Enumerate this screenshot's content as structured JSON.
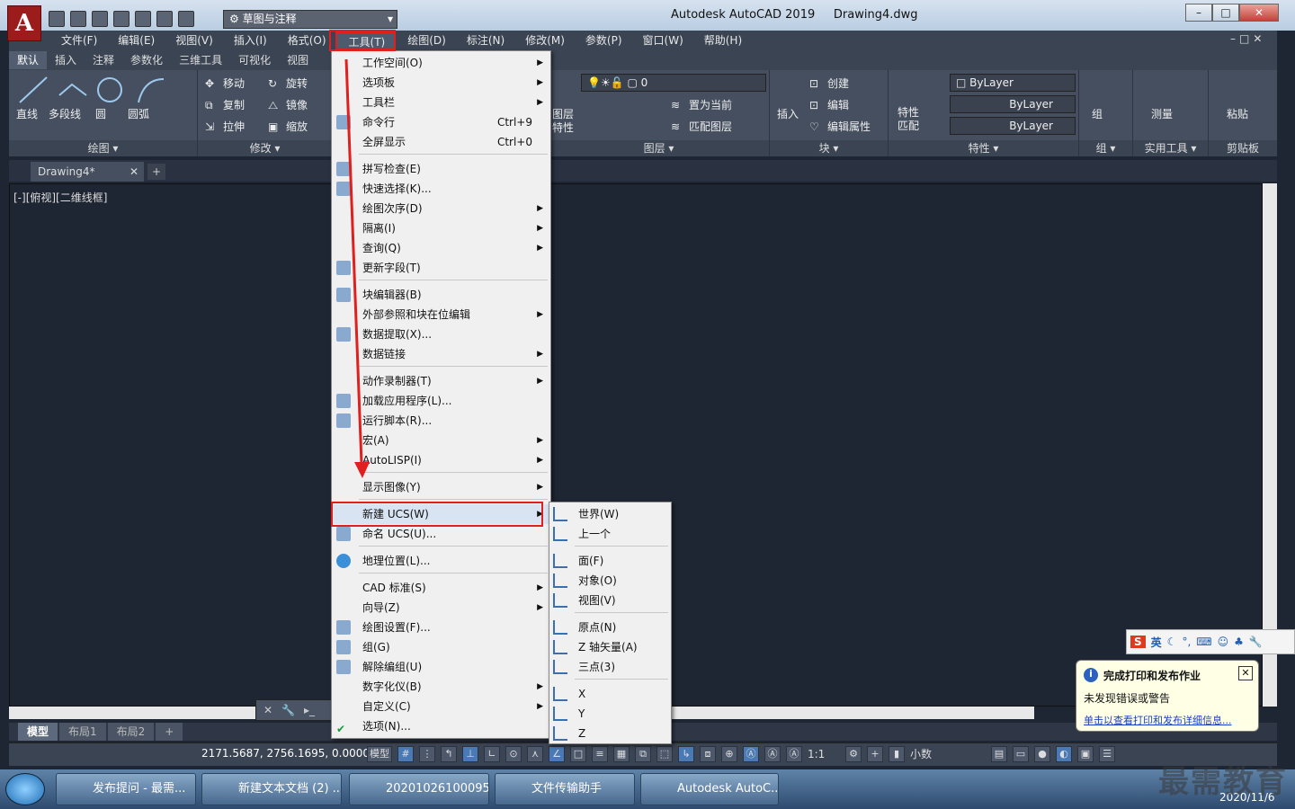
{
  "window": {
    "title": "Autodesk AutoCAD 2019",
    "document": "Drawing4.dwg",
    "workspace": "草图与注释"
  },
  "menubar": {
    "items": [
      "文件(F)",
      "编辑(E)",
      "视图(V)",
      "插入(I)",
      "格式(O)",
      "工具(T)",
      "绘图(D)",
      "标注(N)",
      "修改(M)",
      "参数(P)",
      "窗口(W)",
      "帮助(H)"
    ]
  },
  "ribbon": {
    "tabs": [
      "默认",
      "插入",
      "注释",
      "参数化",
      "三维工具",
      "可视化",
      "视图"
    ],
    "draw": {
      "line": "直线",
      "polyline": "多段线",
      "circle": "圆",
      "arc": "圆弧",
      "label": "绘图"
    },
    "modify": {
      "move": "移动",
      "rotate": "旋转",
      "copy": "复制",
      "mirror": "镜像",
      "stretch": "拉伸",
      "scale": "缩放",
      "label": "修改"
    },
    "layers": {
      "current": "0",
      "set_current": "置为当前",
      "match": "匹配图层",
      "label": "图层",
      "props1": "图层",
      "props2": "特性"
    },
    "block": {
      "insert": "插入",
      "create": "创建",
      "edit": "编辑",
      "edit_attr": "编辑属性",
      "label": "块"
    },
    "properties": {
      "match1": "特性",
      "match2": "匹配",
      "color": "ByLayer",
      "linetype": "ByLayer",
      "lineweight": "ByLayer",
      "label": "特性"
    },
    "groups": {
      "group": "组",
      "label": "组"
    },
    "utilities": {
      "measure": "测量",
      "label": "实用工具"
    },
    "clipboard": {
      "paste": "粘贴",
      "label": "剪贴板"
    }
  },
  "doc": {
    "tab": "Drawing4*",
    "view_label": "[-][俯视][二维线框]"
  },
  "tools_menu": {
    "items": [
      {
        "label": "工作空间(O)",
        "arrow": true
      },
      {
        "label": "选项板",
        "arrow": true
      },
      {
        "label": "工具栏",
        "arrow": true
      },
      {
        "label": "命令行",
        "shortcut": "Ctrl+9"
      },
      {
        "label": "全屏显示",
        "shortcut": "Ctrl+0"
      },
      {
        "label": "拼写检查(E)"
      },
      {
        "label": "快速选择(K)..."
      },
      {
        "label": "绘图次序(D)",
        "arrow": true
      },
      {
        "label": "隔离(I)",
        "arrow": true
      },
      {
        "label": "查询(Q)",
        "arrow": true
      },
      {
        "label": "更新字段(T)"
      },
      {
        "label": "块编辑器(B)"
      },
      {
        "label": "外部参照和块在位编辑",
        "arrow": true
      },
      {
        "label": "数据提取(X)..."
      },
      {
        "label": "数据链接",
        "arrow": true
      },
      {
        "label": "动作录制器(T)",
        "arrow": true
      },
      {
        "label": "加载应用程序(L)..."
      },
      {
        "label": "运行脚本(R)..."
      },
      {
        "label": "宏(A)",
        "arrow": true
      },
      {
        "label": "AutoLISP(I)",
        "arrow": true
      },
      {
        "label": "显示图像(Y)",
        "arrow": true
      },
      {
        "label": "新建 UCS(W)",
        "arrow": true
      },
      {
        "label": "命名 UCS(U)..."
      },
      {
        "label": "地理位置(L)..."
      },
      {
        "label": "CAD 标准(S)",
        "arrow": true
      },
      {
        "label": "向导(Z)",
        "arrow": true
      },
      {
        "label": "绘图设置(F)..."
      },
      {
        "label": "组(G)"
      },
      {
        "label": "解除编组(U)"
      },
      {
        "label": "数字化仪(B)",
        "arrow": true
      },
      {
        "label": "自定义(C)",
        "arrow": true
      },
      {
        "label": "选项(N)..."
      }
    ]
  },
  "ucs_submenu": {
    "items": [
      "世界(W)",
      "上一个",
      "面(F)",
      "对象(O)",
      "视图(V)",
      "原点(N)",
      "Z 轴矢量(A)",
      "三点(3)",
      "X",
      "Y",
      "Z"
    ]
  },
  "layout_tabs": [
    "模型",
    "布局1",
    "布局2"
  ],
  "status": {
    "coords": "2171.5687, 2756.1695, 0.0000",
    "model": "模型",
    "scale": "1:1",
    "units": "小数"
  },
  "notification": {
    "title": "完成打印和发布作业",
    "body": "未发现错误或警告",
    "link": "单击以查看打印和发布详细信息..."
  },
  "ime": {
    "lang": "英"
  },
  "taskbar": {
    "items": [
      "发布提问 - 最需...",
      "新建文本文档 (2) ...",
      "20201026100095...",
      "文件传输助手",
      "Autodesk AutoC..."
    ],
    "date": "2020/11/6"
  },
  "watermark": "最需教育",
  "colors": {
    "highlight": "#e0201e",
    "arrow": "#e0201e"
  }
}
